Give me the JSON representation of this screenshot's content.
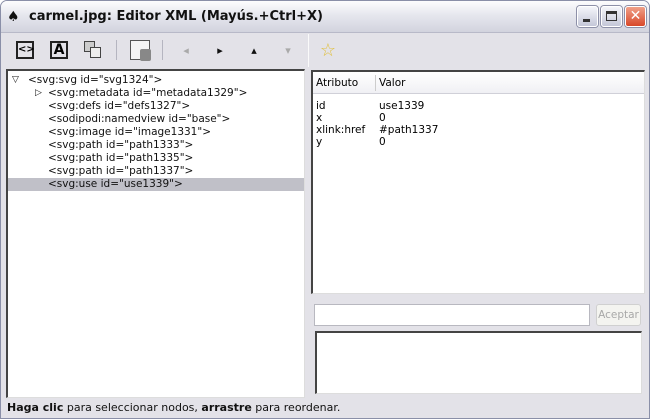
{
  "window": {
    "title": "carmel.jpg: Editor XML (Mayús.+Ctrl+X)"
  },
  "toolbar": {
    "buttons": [
      "new-element-node-icon",
      "new-text-node-icon",
      "duplicate-node-icon",
      "delete-node-icon",
      "unindent-node-icon",
      "indent-node-icon",
      "raise-node-icon",
      "lower-node-icon"
    ],
    "right_button": "set-attribute-icon"
  },
  "tree": {
    "nodes": [
      {
        "label": "<svg:svg id=\"svg1324\">",
        "expander": "expanded"
      },
      {
        "label": "<svg:metadata id=\"metadata1329\">",
        "expander": "collapsed"
      },
      {
        "label": "<svg:defs id=\"defs1327\">"
      },
      {
        "label": "<sodipodi:namedview id=\"base\">"
      },
      {
        "label": "<svg:image id=\"image1331\">"
      },
      {
        "label": "<svg:path id=\"path1333\">"
      },
      {
        "label": "<svg:path id=\"path1335\">"
      },
      {
        "label": "<svg:path id=\"path1337\">"
      },
      {
        "label": "<svg:use id=\"use1339\">",
        "selected": true
      }
    ]
  },
  "attributes": {
    "col_attr": "Atributo",
    "col_value": "Valor",
    "rows": [
      {
        "name": "id",
        "value": "use1339"
      },
      {
        "name": "x",
        "value": "0"
      },
      {
        "name": "xlink:href",
        "value": "#path1337"
      },
      {
        "name": "y",
        "value": "0"
      }
    ]
  },
  "editor": {
    "name_value": "",
    "accept_label": "Aceptar",
    "value_text": ""
  },
  "status": {
    "b1": "Haga clic",
    "t1": " para seleccionar nodos, ",
    "b2": "arrastre",
    "t2": " para reordenar."
  }
}
